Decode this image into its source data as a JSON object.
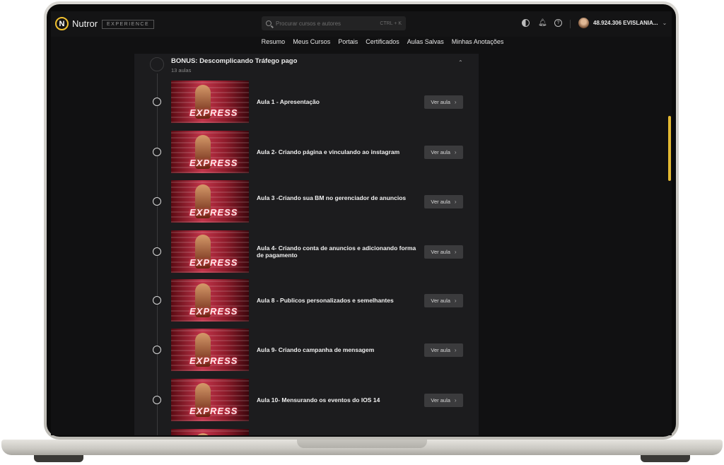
{
  "app": {
    "logo_text": "Nutror",
    "badge": "EXPERIENCE",
    "accent_color": "#f2c230"
  },
  "search": {
    "placeholder": "Procurar cursos e autores",
    "shortcut": "CTRL + K"
  },
  "user": {
    "name": "48.924.306 EVISLANIA..."
  },
  "nav": {
    "items": [
      "Resumo",
      "Meus Cursos",
      "Portais",
      "Certificados",
      "Aulas Salvas",
      "Minhas Anotações"
    ]
  },
  "module": {
    "title": "BONUS: Descomplicando Tráfego pago",
    "count": "13 aulas"
  },
  "lessons": [
    {
      "title": "Aula 1 - Apresentação",
      "button": "Ver aula"
    },
    {
      "title": "Aula 2- Criando página e vinculando ao instagram",
      "button": "Ver aula"
    },
    {
      "title": "Aula 3 -Criando sua BM no gerenciador de anuncios",
      "button": "Ver aula"
    },
    {
      "title": "Aula 4- Criando conta de anuncios e adicionando forma de pagamento",
      "button": "Ver aula"
    },
    {
      "title": "Aula 8 - Publicos personalizados e semelhantes",
      "button": "Ver aula"
    },
    {
      "title": "Aula 9- Criando campanha de mensagem",
      "button": "Ver aula"
    },
    {
      "title": "Aula 10- Mensurando os eventos do IOS 14",
      "button": "Ver aula"
    }
  ],
  "thumb_word": "EXPRESS"
}
